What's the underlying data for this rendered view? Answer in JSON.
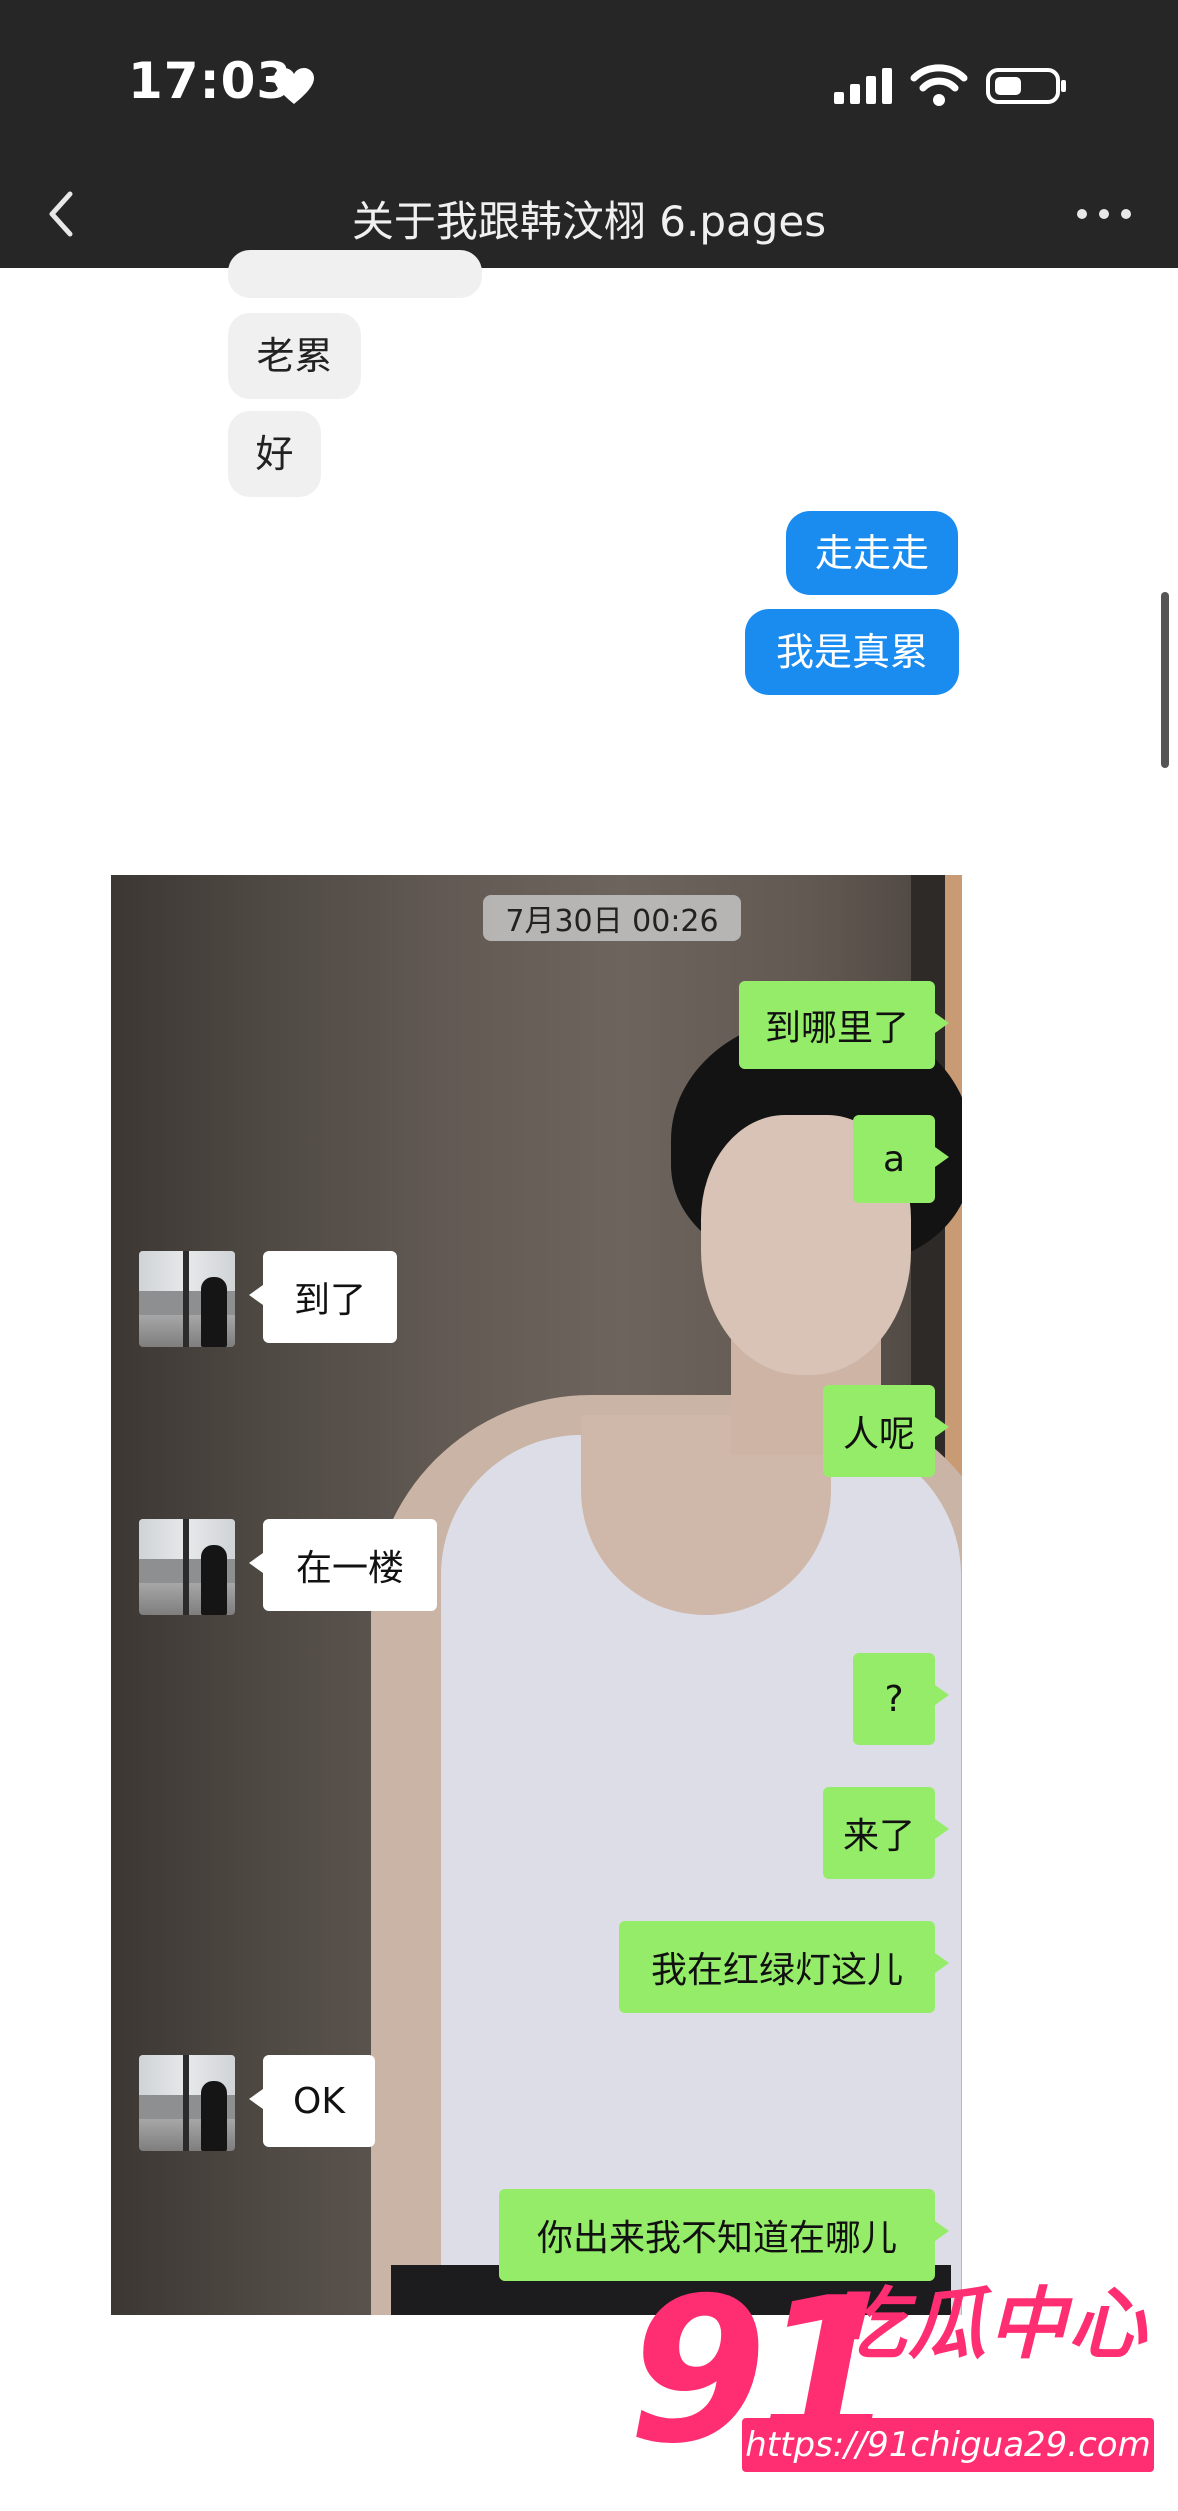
{
  "status_bar": {
    "time": "17:03"
  },
  "nav": {
    "title": "关于我跟韩汶栩 6.pages"
  },
  "document": {
    "top_messages": [
      {
        "text": "老累",
        "side": "received"
      },
      {
        "text": "好",
        "side": "received"
      },
      {
        "text": "走走走",
        "side": "sent"
      },
      {
        "text": "我是真累",
        "side": "sent"
      }
    ]
  },
  "embedded_chat": {
    "timestamp": "7月30日 00:26",
    "messages": [
      {
        "text": "到哪里了",
        "side": "sent"
      },
      {
        "text": "a",
        "side": "sent"
      },
      {
        "text": "到了",
        "side": "received"
      },
      {
        "text": "人呢",
        "side": "sent"
      },
      {
        "text": "在一楼",
        "side": "received"
      },
      {
        "text": "?",
        "side": "sent"
      },
      {
        "text": "来了",
        "side": "sent"
      },
      {
        "text": "我在红绿灯这儿",
        "side": "sent"
      },
      {
        "text": "OK",
        "side": "received"
      },
      {
        "text": "你出来我不知道在哪儿",
        "side": "sent"
      }
    ]
  },
  "watermark": {
    "number": "91",
    "name": "吃瓜中心",
    "url": "https://91chigua29.com"
  },
  "colors": {
    "bar": "#262626",
    "sent_blue": "#1a8cf0",
    "wechat_green": "#95ec69",
    "watermark_pink": "#ff2e72"
  }
}
